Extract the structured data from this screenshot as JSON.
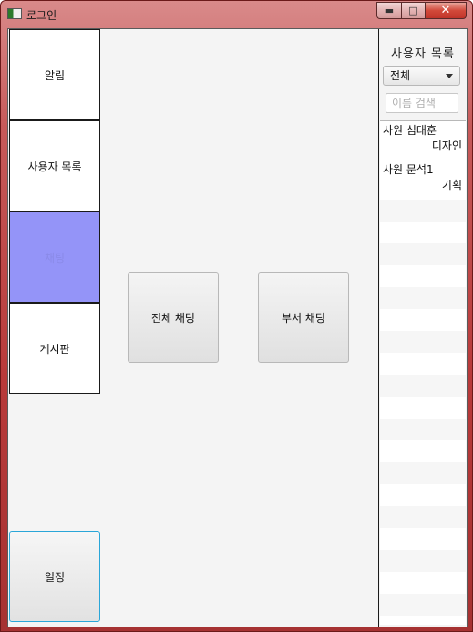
{
  "window": {
    "title": "로그인",
    "minimize_label": "▬",
    "maximize_label": "□",
    "close_label": "✕"
  },
  "nav": {
    "notifications": "알림",
    "user_list": "사용자 목록",
    "chat": "채팅",
    "board": "게시판",
    "schedule": "일정"
  },
  "chat_buttons": {
    "all": "전체 채팅",
    "dept": "부서 채팅"
  },
  "right_panel": {
    "title": "사용자 목록",
    "dept_selected": "전체",
    "search_placeholder": "이름 검색",
    "users": [
      {
        "line1": "사원 심대훈",
        "line2": "디자인"
      },
      {
        "line1": "사원 문석1",
        "line2": "기획"
      }
    ]
  },
  "colors": {
    "frame": "#b83a3a",
    "active_nav": "#9494f8",
    "focus_border": "#2aa6d8"
  }
}
